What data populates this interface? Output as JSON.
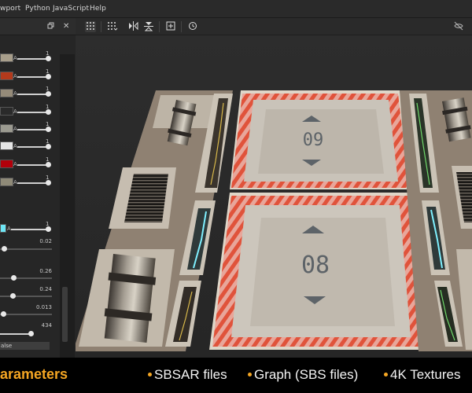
{
  "menu": {
    "viewport": "wport",
    "python": "Python",
    "javascript": "JavaScript",
    "help": "Help"
  },
  "panel": {
    "icons": [
      "restore-icon",
      "close-icon"
    ],
    "color_rows": [
      {
        "color": "#a89e8b",
        "a": "A",
        "value": "1"
      },
      {
        "color": "#b33a1c",
        "a": "A",
        "value": "1"
      },
      {
        "color": "#958b79",
        "a": "A",
        "value": "1"
      },
      {
        "color": "#2a2a2a",
        "a": "A",
        "value": "1"
      },
      {
        "color": "#9b9a90",
        "a": "A",
        "value": "1"
      },
      {
        "color": "#e5e5e5",
        "a": "A",
        "value": "1"
      },
      {
        "color": "#b1000a",
        "a": "A",
        "value": "1"
      },
      {
        "color": "#8f8a78",
        "a": "A",
        "value": "1"
      }
    ],
    "cyan_row": {
      "color": "#6ee6f5",
      "a": "A",
      "value": "1"
    },
    "values": [
      "0.02",
      "0.26",
      "0.24",
      "0.013",
      "434"
    ],
    "false_label": "alse"
  },
  "toolbar": {
    "icons": [
      "grid-icon",
      "grid-options-icon",
      "flip-horizontal-icon",
      "flip-vertical-icon",
      "frame-icon",
      "history-icon",
      "hide-icon"
    ]
  },
  "viewport": {
    "panel_top_number": "09",
    "panel_bottom_number": "08"
  },
  "banner": {
    "title": "arameters",
    "items": [
      "SBSAR files",
      "Graph (SBS files)",
      "4K Textures"
    ],
    "accent_color": "#f5a623"
  }
}
